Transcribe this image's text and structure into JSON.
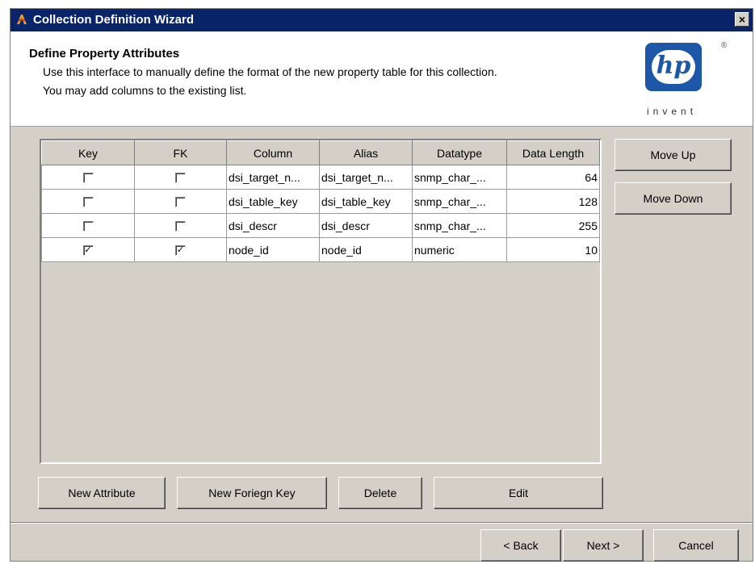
{
  "window": {
    "title": "Collection Definition Wizard",
    "close_label": "×"
  },
  "header": {
    "title": "Define Property Attributes",
    "desc_line1": "Use this interface to manually define the format of the new property table for this collection.",
    "desc_line2": "You may add columns to the existing list.",
    "logo_mark": "hp",
    "logo_tagline": "invent",
    "logo_reg": "®"
  },
  "table": {
    "columns": [
      "Key",
      "FK",
      "Column",
      "Alias",
      "Datatype",
      "Data Length"
    ],
    "rows": [
      {
        "key": false,
        "fk": false,
        "column": "dsi_target_n...",
        "alias": "dsi_target_n...",
        "datatype": "snmp_char_...",
        "length": "64"
      },
      {
        "key": false,
        "fk": false,
        "column": "dsi_table_key",
        "alias": "dsi_table_key",
        "datatype": "snmp_char_...",
        "length": "128"
      },
      {
        "key": false,
        "fk": false,
        "column": "dsi_descr",
        "alias": "dsi_descr",
        "datatype": "snmp_char_...",
        "length": "255"
      },
      {
        "key": true,
        "fk": true,
        "column": "node_id",
        "alias": "node_id",
        "datatype": "numeric",
        "length": "10"
      }
    ]
  },
  "side_buttons": {
    "move_up": "Move Up",
    "move_down": "Move Down"
  },
  "action_buttons": {
    "new_attribute": "New Attribute",
    "new_foreign_key": "New Foriegn Key",
    "delete": "Delete",
    "edit": "Edit"
  },
  "nav_buttons": {
    "back": "< Back",
    "next": "Next >",
    "cancel": "Cancel"
  }
}
